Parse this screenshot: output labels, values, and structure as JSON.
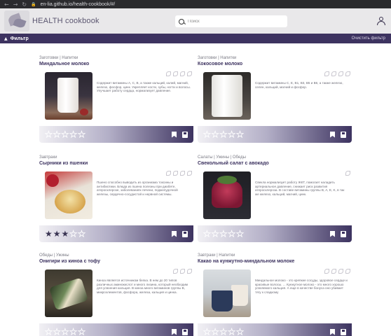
{
  "browser": {
    "back": "←",
    "forward": "→",
    "reload": "↻",
    "lock": "🔒",
    "url": "en-lia.github.io/health-cookbook/#/"
  },
  "header": {
    "site_title": "HEALTH cookbook",
    "search_placeholder": "Поиск"
  },
  "filterbar": {
    "toggle_label": "Фильтр",
    "clear_label": "Очистить фильтр"
  },
  "colors": {
    "accent": "#3d3360",
    "header_bg": "#e9e8ea"
  },
  "recipes": [
    {
      "categories": "Заготовки | Напитки",
      "title": "Миндальное молоко",
      "description": "Содержит витамины A, C, B, а также кальций, калий, магний, железо, фосфор, цинк. Укрепляет кости, зубы, ногти и волосы. Улучшает работу сердца, нормализует давление.",
      "rating": 0,
      "photo": "almond-milk-glass"
    },
    {
      "categories": "Заготовки | Напитки",
      "title": "Кокосовое молоко",
      "description": "Содержит витамины C, E, B1, B3, B5 и B6, а также железо, селен, кальций, магний и фосфор.",
      "rating": 0,
      "photo": "coconut-milk-glass"
    },
    {
      "categories": "Завтраки",
      "title": "Сырники из пшенки",
      "description": "Пшено способно выводить из организма токсины и антибиотики. Блюда из пшена полезны при диабете, атеросклерозе, заболеваниях печени, поджелудочной железы, сердечно-сосудистой и нервной системы.",
      "rating": 3,
      "photo": "millet-syrniki"
    },
    {
      "categories": "Салаты | Ужины | Обеды",
      "title": "Свекольный салат с авокадо",
      "description": "Свекла нормализует работу ЖКТ, помогает наладить артериальное давление, снижает риск развития атеросклероза. В составе витамины группы B, A, E, K, в так же железо, кальций, магний, цинк.",
      "rating": 0,
      "photo": "beet-avocado-salad"
    },
    {
      "categories": "Обеды | Ужины",
      "title": "Онигири из киноа с тофу",
      "description": "Киноа является источником белка. В нем до 20 типов различных аминокислот и много лизина, который необходим для усвоения кальция. В киноа много витаминов группы B, микроэлементов, фосфора, железа, кальция и цинка.",
      "rating": 0,
      "photo": "quinoa-onigiri"
    },
    {
      "categories": "Завтраки | Напитки",
      "title": "Какао на кунжутно-миндальном молоке",
      "description": "Миндальное молоко - это крепкие сосуды, здоровое сердце и красивые волосы. ... Кунжутное молоко - это много хорошо усвояемого кальция. А еще в качестве бонуса оно убивает тягу к сладкому",
      "rating": 0,
      "photo": "cocoa-cups"
    }
  ]
}
